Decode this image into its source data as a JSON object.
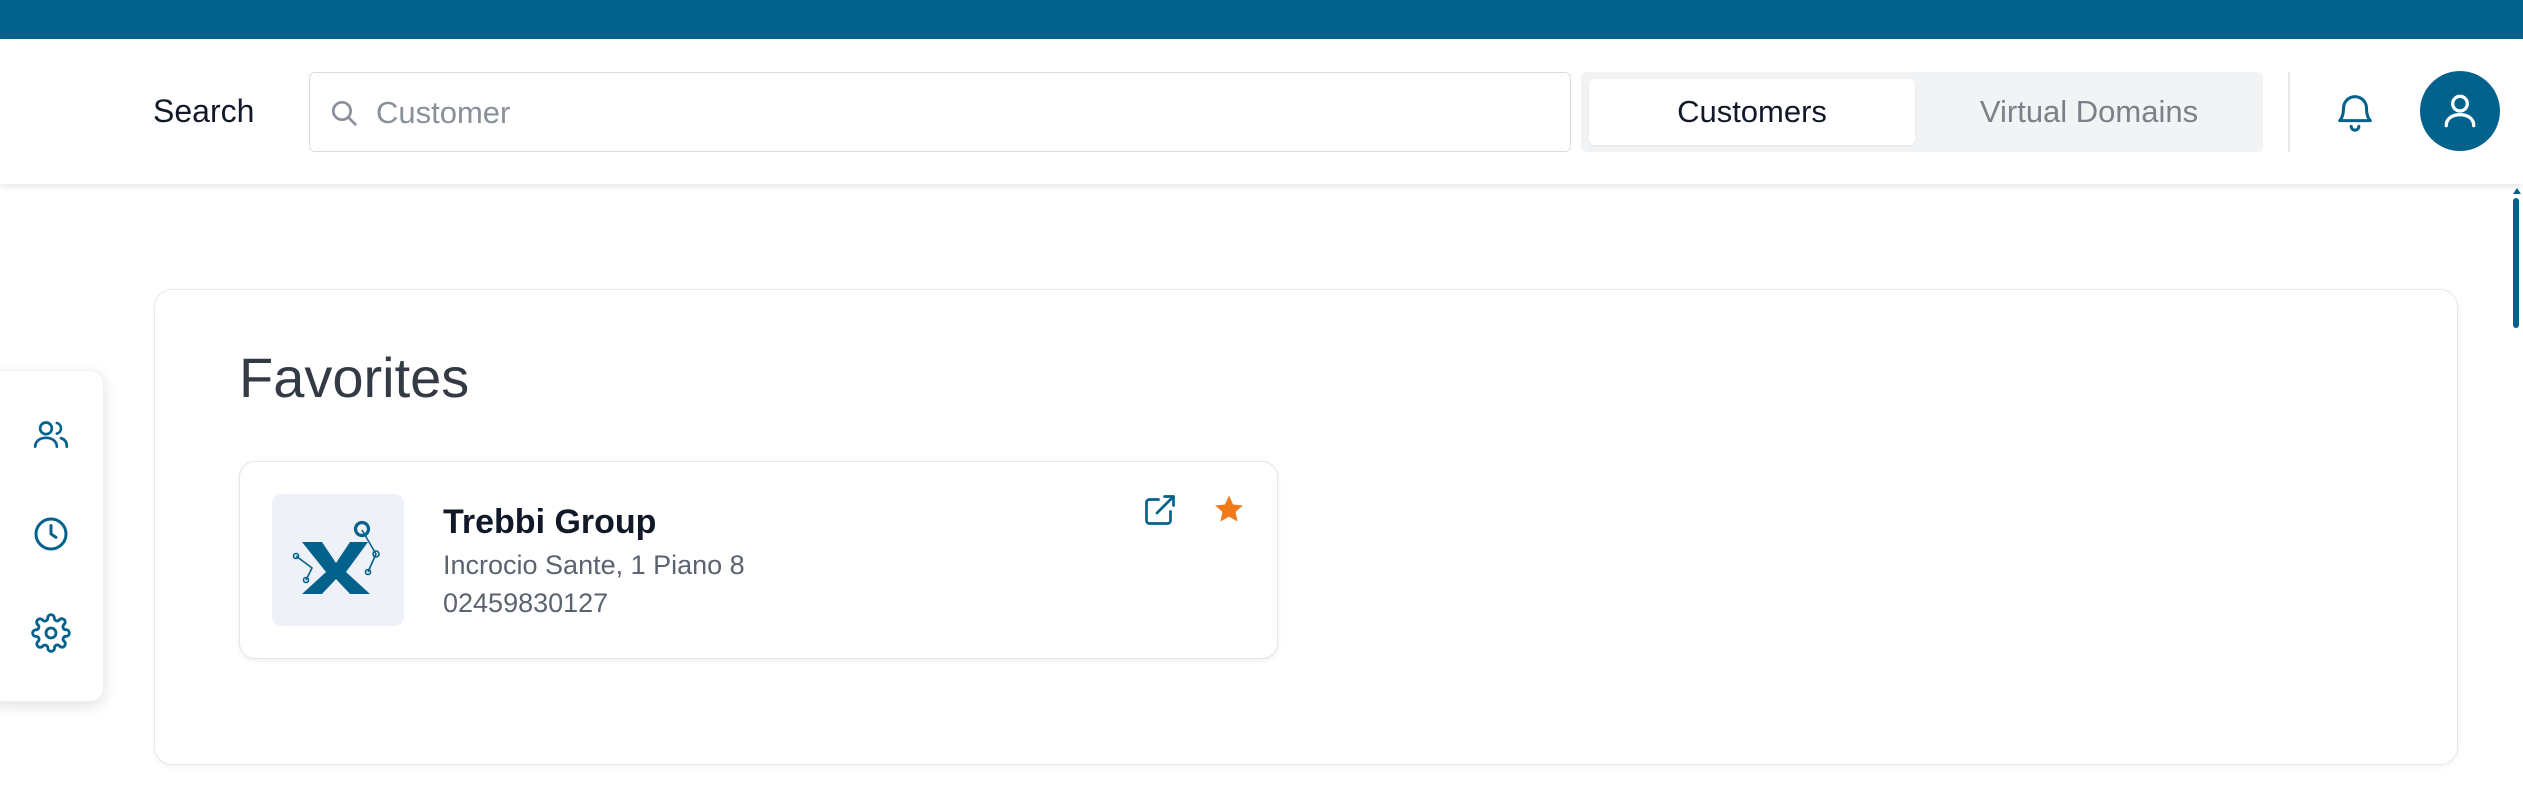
{
  "colors": {
    "brand": "#03628c",
    "favorite_star": "#f07a1a",
    "background": "#ffffff"
  },
  "header": {
    "search_label": "Search",
    "search_placeholder": "Customer",
    "search_value": "",
    "toggle": {
      "options": [
        "Customers",
        "Virtual Domains"
      ],
      "selected": "Customers"
    }
  },
  "icons": {
    "search": "search-icon",
    "bell": "bell-icon",
    "user": "user-icon",
    "rail": [
      "users-icon",
      "clock-icon",
      "gear-icon"
    ],
    "open_external": "external-link-icon",
    "favorite": "star-icon"
  },
  "favorites": {
    "title": "Favorites",
    "items": [
      {
        "name": "Trebbi Group",
        "address": "Incrocio Sante, 1 Piano 8",
        "phone": "02459830127",
        "is_favorite": true
      }
    ]
  }
}
